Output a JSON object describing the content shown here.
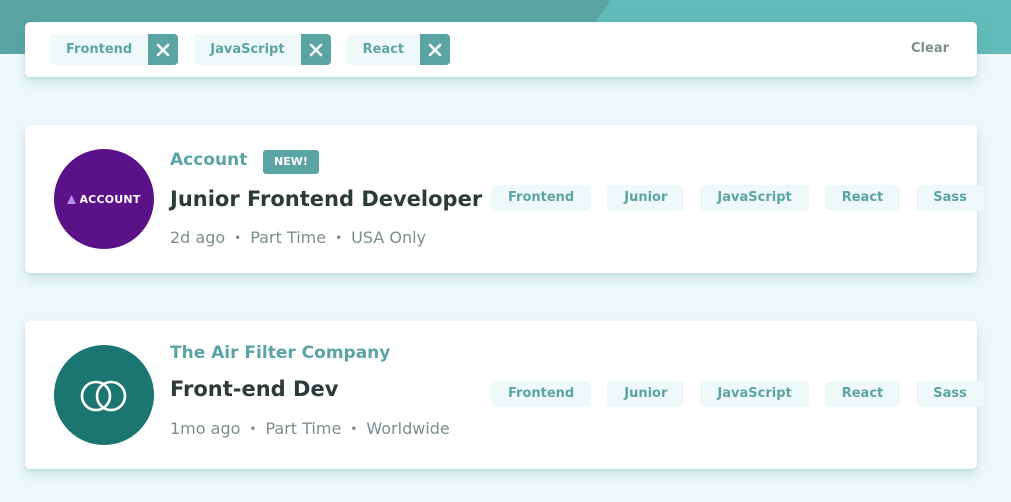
{
  "filters": {
    "chips": [
      {
        "label": "Frontend"
      },
      {
        "label": "JavaScript"
      },
      {
        "label": "React"
      }
    ],
    "clear_label": "Clear"
  },
  "jobs": [
    {
      "company": "Account",
      "logo_text": "ACCOUNT",
      "badge": "NEW!",
      "position": "Junior Frontend Developer",
      "posted": "2d ago",
      "contract": "Part Time",
      "location": "USA Only",
      "tags": [
        "Frontend",
        "Junior",
        "JavaScript",
        "React",
        "Sass"
      ]
    },
    {
      "company": "The Air Filter Company",
      "position": "Front-end Dev",
      "posted": "1mo ago",
      "contract": "Part Time",
      "location": "Worldwide",
      "tags": [
        "Frontend",
        "Junior",
        "JavaScript",
        "React",
        "Sass"
      ]
    }
  ],
  "meta_separator": "•",
  "colors": {
    "primary": "#5ba4a4",
    "background": "#eff9fa",
    "account_logo": "#5b1187",
    "airfilter_logo": "#1b7571"
  }
}
